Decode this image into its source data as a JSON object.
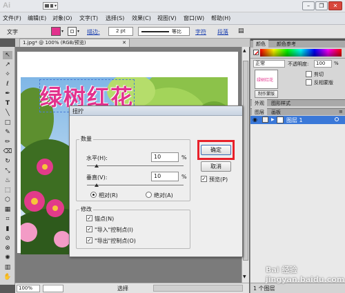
{
  "app": {
    "logo": "Ai",
    "arrange_icon": "arrange-documents-icon"
  },
  "window_controls": {
    "minimize": "–",
    "restore": "❐",
    "close": "✕"
  },
  "menu": [
    "文件(F)",
    "编辑(E)",
    "对象(O)",
    "文字(T)",
    "选择(S)",
    "效果(C)",
    "视图(V)",
    "窗口(W)",
    "帮助(H)"
  ],
  "control_bar": {
    "mode_label": "文字",
    "fill_color": "#e2328d",
    "stroke_label": "描边:",
    "stroke_weight": "2 pt",
    "stroke_profile": "等比",
    "char_link": "字符",
    "para_link": "段落"
  },
  "document_tab": {
    "title": "1.jpg* @ 100% (RGB/预览)",
    "close": "✕"
  },
  "artwork_text": "绿树红花",
  "status_bar": {
    "zoom": "100%",
    "tool": "选择"
  },
  "right_panel": {
    "color_tab": "颜色",
    "color_guide_tab": "颜色参考",
    "blend_mode": "正常",
    "opacity_label": "不透明度:",
    "opacity_value": "100",
    "opacity_unit": "%",
    "mask_button": "制作蒙版",
    "clip_label": "剪切",
    "invert_mask_label": "反相蒙版",
    "appearance_tab": "外观",
    "graphic_styles_tab": "图形样式",
    "layers_tab": "图层",
    "artboards_tab": "画板",
    "layer_name": "图层 1",
    "layer_count": "1 个图层"
  },
  "dialog": {
    "title": "扭拧",
    "amount_group": "数量",
    "horizontal_label": "水平(H):",
    "horizontal_value": "10",
    "horizontal_unit": "%",
    "vertical_label": "垂直(V):",
    "vertical_value": "10",
    "vertical_unit": "%",
    "relative_label": "相对(R)",
    "absolute_label": "绝对(A)",
    "modify_group": "修改",
    "anchor_label": "锚点(N)",
    "in_handles_label": "\"导入\"控制点(I)",
    "out_handles_label": "\"导出\"控制点(O)",
    "ok_label": "确定",
    "cancel_label": "取消",
    "preview_label": "预览(P)",
    "horizontal_slider_fraction": 0.1,
    "vertical_slider_fraction": 0.1
  },
  "colors": {
    "highlight": "#e8202a",
    "layer_selected": "#3a78d8",
    "artwork_text": "#e2328d"
  },
  "watermark": "Bai 经验 jingyan.baidu.com"
}
